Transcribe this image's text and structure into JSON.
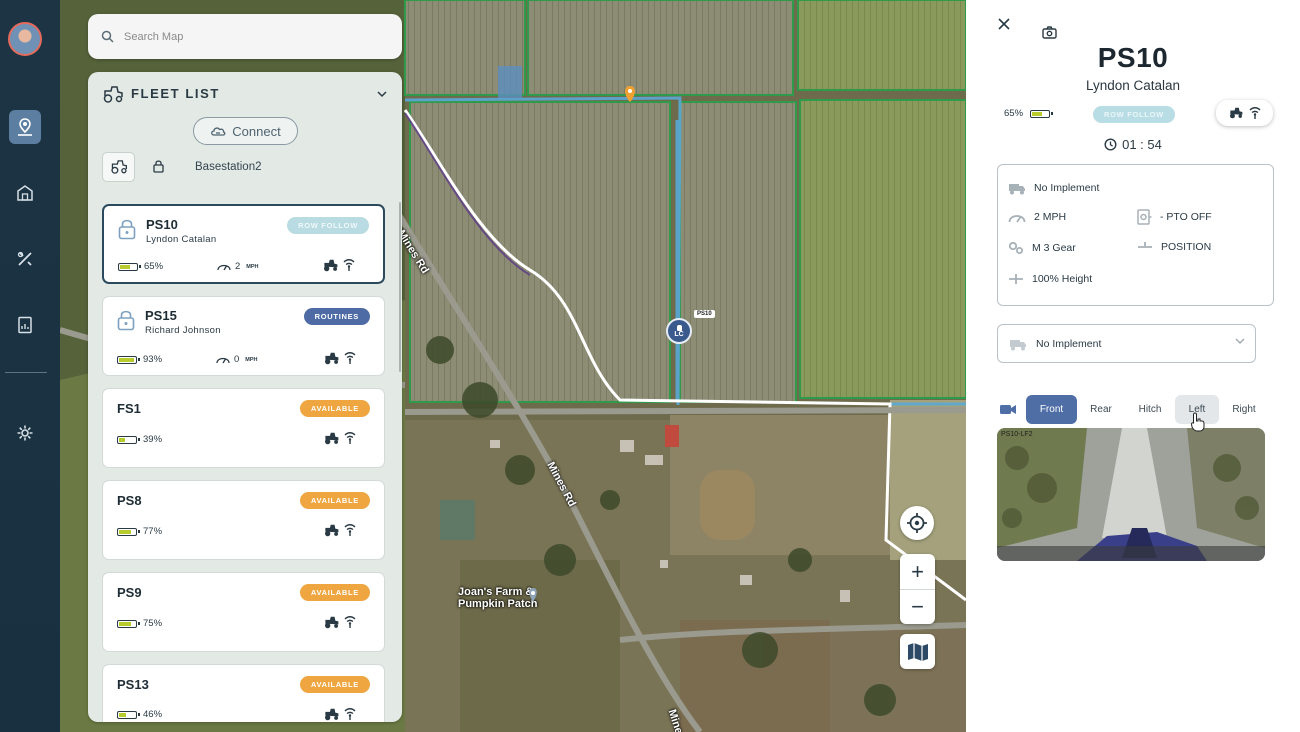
{
  "search": {
    "placeholder": "Search Map"
  },
  "fleet": {
    "title": "FLEET LIST",
    "connect_label": "Connect",
    "basestation": "Basestation2",
    "vehicles": [
      {
        "name": "PS10",
        "user": "Lyndon Catalan",
        "status": "ROW FOLLOW",
        "battery": "65%",
        "battery_level": 0.65,
        "speed": "2",
        "speed_unit": "MPH"
      },
      {
        "name": "PS15",
        "user": "Richard Johnson",
        "status": "ROUTINES",
        "battery": "93%",
        "battery_level": 0.93,
        "speed": "0",
        "speed_unit": "MPH"
      },
      {
        "name": "FS1",
        "status": "AVAILABLE",
        "battery": "39%",
        "battery_level": 0.39
      },
      {
        "name": "PS8",
        "status": "AVAILABLE",
        "battery": "77%",
        "battery_level": 0.77
      },
      {
        "name": "PS9",
        "status": "AVAILABLE",
        "battery": "75%",
        "battery_level": 0.75
      },
      {
        "name": "PS13",
        "status": "AVAILABLE",
        "battery": "46%",
        "battery_level": 0.46
      }
    ]
  },
  "map": {
    "road_labels": [
      "Mines Rd",
      "Mines Rd",
      "Mines Rd"
    ],
    "poi_label_1": "Joan's Farm &",
    "poi_label_2": "Pumpkin Patch",
    "marker_initials": "LC",
    "marker_tag": "PS10"
  },
  "detail": {
    "title": "PS10",
    "subtitle": "Lyndon Catalan",
    "battery": "65%",
    "battery_level": 0.65,
    "mode_badge": "ROW FOLLOW",
    "timer": "01 : 54",
    "status": {
      "implement": "No Implement",
      "speed": "2 MPH",
      "pto": "-  PTO OFF",
      "gear": "M 3 Gear",
      "position": "POSITION",
      "height": "100% Height"
    },
    "implement_select": "No Implement",
    "camera_tabs": [
      "Front",
      "Rear",
      "Hitch",
      "Left",
      "Right"
    ],
    "active_camera": "Front",
    "camera_overlay": "PS10-LF2"
  },
  "colors": {
    "nav_bg": "#1c3444",
    "nav_active": "#5c7ea1",
    "badge_available": "#efa640",
    "badge_routines": "#4e6ba6",
    "badge_row_follow": "#b9dbe2",
    "battery_fill": "#b9cc2e",
    "tab_active": "#4f6ea6"
  }
}
